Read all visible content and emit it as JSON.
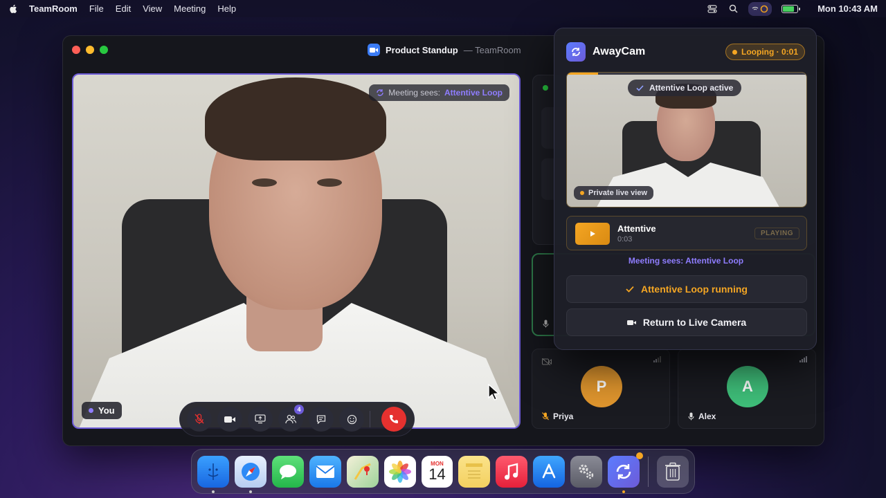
{
  "menubar": {
    "app_name": "TeamRoom",
    "menus": [
      "File",
      "Edit",
      "View",
      "Meeting",
      "Help"
    ],
    "clock": "Mon 10:43 AM"
  },
  "window": {
    "title": "Product Standup",
    "subtitle": "— TeamRoom"
  },
  "main_video": {
    "meeting_sees_prefix": "Meeting sees:",
    "meeting_sees_value": "Attentive Loop",
    "self_label": "You"
  },
  "controls": {
    "participants_badge": "4"
  },
  "participants": [
    {
      "initial": "P",
      "name": "Priya",
      "color": "#e0962e"
    },
    {
      "initial": "A",
      "name": "Alex",
      "color": "#3fbf7a"
    }
  ],
  "awaycam": {
    "title": "AwayCam",
    "status": "Looping · 0:01",
    "preview_chip": "Attentive Loop active",
    "private_chip": "Private live view",
    "loop_progress": 0.13,
    "clip": {
      "name": "Attentive",
      "duration": "0:03",
      "state": "PLAYING"
    },
    "meeting_sees": "Meeting sees: Attentive Loop",
    "loop_button": "Attentive Loop running",
    "live_button": "Return to Live Camera"
  },
  "colors": {
    "accent_purple": "#8f7dff",
    "accent_orange": "#f5a623",
    "end_call_red": "#e5312f"
  },
  "dock": {
    "calendar_month": "MON",
    "calendar_day": "14",
    "items": [
      "finder-icon",
      "safari-icon",
      "messages-icon",
      "mail-icon",
      "maps-icon",
      "photos-icon",
      "calendar-icon",
      "notes-icon",
      "music-icon",
      "app-store-icon",
      "settings-icon",
      "awaycam-icon",
      "trash-icon"
    ]
  }
}
